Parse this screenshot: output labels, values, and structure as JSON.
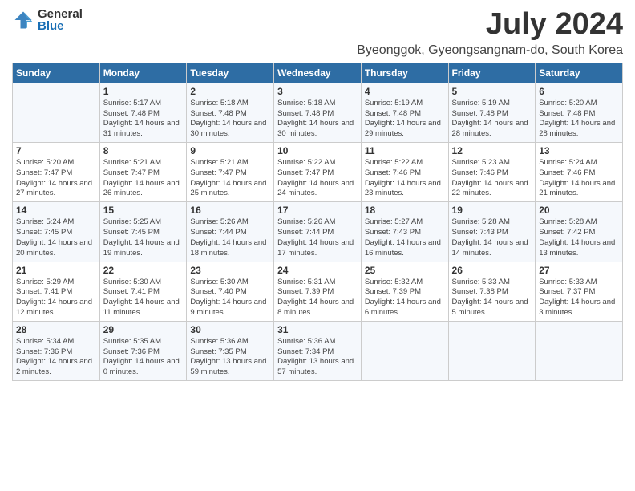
{
  "logo": {
    "general": "General",
    "blue": "Blue"
  },
  "title": "July 2024",
  "subtitle": "Byeonggok, Gyeongsangnam-do, South Korea",
  "days_of_week": [
    "Sunday",
    "Monday",
    "Tuesday",
    "Wednesday",
    "Thursday",
    "Friday",
    "Saturday"
  ],
  "weeks": [
    [
      {
        "day": "",
        "info": ""
      },
      {
        "day": "1",
        "sunrise": "Sunrise: 5:17 AM",
        "sunset": "Sunset: 7:48 PM",
        "daylight": "Daylight: 14 hours and 31 minutes."
      },
      {
        "day": "2",
        "sunrise": "Sunrise: 5:18 AM",
        "sunset": "Sunset: 7:48 PM",
        "daylight": "Daylight: 14 hours and 30 minutes."
      },
      {
        "day": "3",
        "sunrise": "Sunrise: 5:18 AM",
        "sunset": "Sunset: 7:48 PM",
        "daylight": "Daylight: 14 hours and 30 minutes."
      },
      {
        "day": "4",
        "sunrise": "Sunrise: 5:19 AM",
        "sunset": "Sunset: 7:48 PM",
        "daylight": "Daylight: 14 hours and 29 minutes."
      },
      {
        "day": "5",
        "sunrise": "Sunrise: 5:19 AM",
        "sunset": "Sunset: 7:48 PM",
        "daylight": "Daylight: 14 hours and 28 minutes."
      },
      {
        "day": "6",
        "sunrise": "Sunrise: 5:20 AM",
        "sunset": "Sunset: 7:48 PM",
        "daylight": "Daylight: 14 hours and 28 minutes."
      }
    ],
    [
      {
        "day": "7",
        "sunrise": "Sunrise: 5:20 AM",
        "sunset": "Sunset: 7:47 PM",
        "daylight": "Daylight: 14 hours and 27 minutes."
      },
      {
        "day": "8",
        "sunrise": "Sunrise: 5:21 AM",
        "sunset": "Sunset: 7:47 PM",
        "daylight": "Daylight: 14 hours and 26 minutes."
      },
      {
        "day": "9",
        "sunrise": "Sunrise: 5:21 AM",
        "sunset": "Sunset: 7:47 PM",
        "daylight": "Daylight: 14 hours and 25 minutes."
      },
      {
        "day": "10",
        "sunrise": "Sunrise: 5:22 AM",
        "sunset": "Sunset: 7:47 PM",
        "daylight": "Daylight: 14 hours and 24 minutes."
      },
      {
        "day": "11",
        "sunrise": "Sunrise: 5:22 AM",
        "sunset": "Sunset: 7:46 PM",
        "daylight": "Daylight: 14 hours and 23 minutes."
      },
      {
        "day": "12",
        "sunrise": "Sunrise: 5:23 AM",
        "sunset": "Sunset: 7:46 PM",
        "daylight": "Daylight: 14 hours and 22 minutes."
      },
      {
        "day": "13",
        "sunrise": "Sunrise: 5:24 AM",
        "sunset": "Sunset: 7:46 PM",
        "daylight": "Daylight: 14 hours and 21 minutes."
      }
    ],
    [
      {
        "day": "14",
        "sunrise": "Sunrise: 5:24 AM",
        "sunset": "Sunset: 7:45 PM",
        "daylight": "Daylight: 14 hours and 20 minutes."
      },
      {
        "day": "15",
        "sunrise": "Sunrise: 5:25 AM",
        "sunset": "Sunset: 7:45 PM",
        "daylight": "Daylight: 14 hours and 19 minutes."
      },
      {
        "day": "16",
        "sunrise": "Sunrise: 5:26 AM",
        "sunset": "Sunset: 7:44 PM",
        "daylight": "Daylight: 14 hours and 18 minutes."
      },
      {
        "day": "17",
        "sunrise": "Sunrise: 5:26 AM",
        "sunset": "Sunset: 7:44 PM",
        "daylight": "Daylight: 14 hours and 17 minutes."
      },
      {
        "day": "18",
        "sunrise": "Sunrise: 5:27 AM",
        "sunset": "Sunset: 7:43 PM",
        "daylight": "Daylight: 14 hours and 16 minutes."
      },
      {
        "day": "19",
        "sunrise": "Sunrise: 5:28 AM",
        "sunset": "Sunset: 7:43 PM",
        "daylight": "Daylight: 14 hours and 14 minutes."
      },
      {
        "day": "20",
        "sunrise": "Sunrise: 5:28 AM",
        "sunset": "Sunset: 7:42 PM",
        "daylight": "Daylight: 14 hours and 13 minutes."
      }
    ],
    [
      {
        "day": "21",
        "sunrise": "Sunrise: 5:29 AM",
        "sunset": "Sunset: 7:41 PM",
        "daylight": "Daylight: 14 hours and 12 minutes."
      },
      {
        "day": "22",
        "sunrise": "Sunrise: 5:30 AM",
        "sunset": "Sunset: 7:41 PM",
        "daylight": "Daylight: 14 hours and 11 minutes."
      },
      {
        "day": "23",
        "sunrise": "Sunrise: 5:30 AM",
        "sunset": "Sunset: 7:40 PM",
        "daylight": "Daylight: 14 hours and 9 minutes."
      },
      {
        "day": "24",
        "sunrise": "Sunrise: 5:31 AM",
        "sunset": "Sunset: 7:39 PM",
        "daylight": "Daylight: 14 hours and 8 minutes."
      },
      {
        "day": "25",
        "sunrise": "Sunrise: 5:32 AM",
        "sunset": "Sunset: 7:39 PM",
        "daylight": "Daylight: 14 hours and 6 minutes."
      },
      {
        "day": "26",
        "sunrise": "Sunrise: 5:33 AM",
        "sunset": "Sunset: 7:38 PM",
        "daylight": "Daylight: 14 hours and 5 minutes."
      },
      {
        "day": "27",
        "sunrise": "Sunrise: 5:33 AM",
        "sunset": "Sunset: 7:37 PM",
        "daylight": "Daylight: 14 hours and 3 minutes."
      }
    ],
    [
      {
        "day": "28",
        "sunrise": "Sunrise: 5:34 AM",
        "sunset": "Sunset: 7:36 PM",
        "daylight": "Daylight: 14 hours and 2 minutes."
      },
      {
        "day": "29",
        "sunrise": "Sunrise: 5:35 AM",
        "sunset": "Sunset: 7:36 PM",
        "daylight": "Daylight: 14 hours and 0 minutes."
      },
      {
        "day": "30",
        "sunrise": "Sunrise: 5:36 AM",
        "sunset": "Sunset: 7:35 PM",
        "daylight": "Daylight: 13 hours and 59 minutes."
      },
      {
        "day": "31",
        "sunrise": "Sunrise: 5:36 AM",
        "sunset": "Sunset: 7:34 PM",
        "daylight": "Daylight: 13 hours and 57 minutes."
      },
      {
        "day": "",
        "info": ""
      },
      {
        "day": "",
        "info": ""
      },
      {
        "day": "",
        "info": ""
      }
    ]
  ]
}
